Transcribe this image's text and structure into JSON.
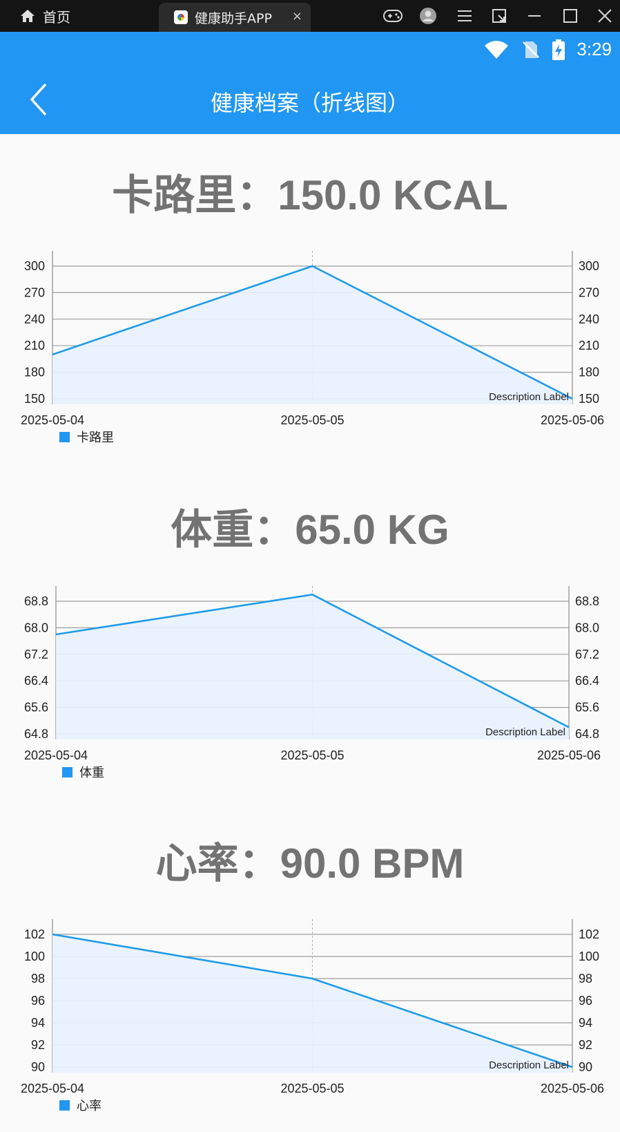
{
  "window": {
    "home_label": "首页",
    "tab_title": "健康助手APP",
    "tab_close": "×"
  },
  "status_bar": {
    "time": "3:29",
    "icons": [
      "wifi-icon",
      "no-sim-icon",
      "battery-charging-icon"
    ]
  },
  "app_bar": {
    "title": "健康档案（折线图）",
    "back_icon": "chevron-left-icon"
  },
  "colors": {
    "accent": "#2196f3",
    "line": "#1e9be9",
    "fill": "#e8f2fd",
    "title_gray": "#737373"
  },
  "sections": [
    {
      "title": "卡路里：150.0 KCAL"
    },
    {
      "title": "体重：65.0 KG"
    },
    {
      "title": "心率：90.0 BPM"
    }
  ],
  "chart_data": [
    {
      "type": "line",
      "x": [
        "2025-05-04",
        "2025-05-05",
        "2025-05-06"
      ],
      "series": [
        {
          "name": "卡路里",
          "values": [
            200,
            300,
            150
          ]
        }
      ],
      "yticks": [
        "150",
        "180",
        "210",
        "240",
        "270",
        "300"
      ],
      "ylim": [
        150,
        300
      ],
      "description": "Description Label",
      "legend": "bottom-left",
      "fill": true,
      "dual_axis": true
    },
    {
      "type": "line",
      "x": [
        "2025-05-04",
        "2025-05-05",
        "2025-05-06"
      ],
      "series": [
        {
          "name": "体重",
          "values": [
            67.8,
            69.0,
            65.0
          ]
        }
      ],
      "yticks": [
        "64.8",
        "65.6",
        "66.4",
        "67.2",
        "68.0",
        "68.8"
      ],
      "ylim": [
        64.8,
        68.8
      ],
      "description": "Description Label",
      "legend": "bottom-left",
      "fill": true,
      "dual_axis": true
    },
    {
      "type": "line",
      "x": [
        "2025-05-04",
        "2025-05-05",
        "2025-05-06"
      ],
      "series": [
        {
          "name": "心率",
          "values": [
            102,
            98,
            90
          ]
        }
      ],
      "yticks": [
        "90",
        "92",
        "94",
        "96",
        "98",
        "100",
        "102"
      ],
      "ylim": [
        90,
        102
      ],
      "description": "Description Label",
      "legend": "bottom-left",
      "fill": true,
      "dual_axis": true
    }
  ]
}
